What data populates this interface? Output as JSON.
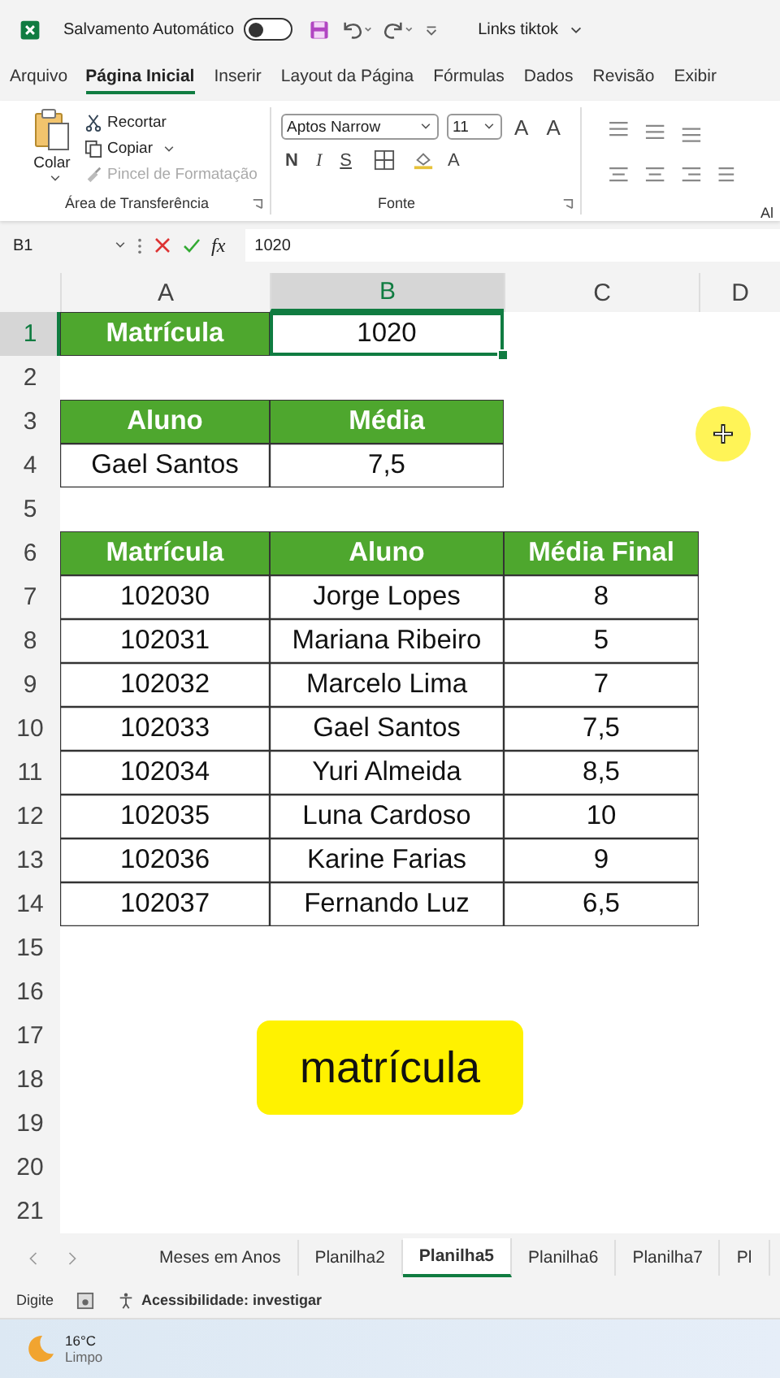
{
  "title_bar": {
    "autosave_label": "Salvamento Automático",
    "autosave_on": false,
    "file_name": "Links tiktok"
  },
  "menu_tabs": [
    {
      "label": "Arquivo",
      "selected": false
    },
    {
      "label": "Página Inicial",
      "selected": true
    },
    {
      "label": "Inserir",
      "selected": false
    },
    {
      "label": "Layout da Página",
      "selected": false
    },
    {
      "label": "Fórmulas",
      "selected": false
    },
    {
      "label": "Dados",
      "selected": false
    },
    {
      "label": "Revisão",
      "selected": false
    },
    {
      "label": "Exibir",
      "selected": false
    }
  ],
  "ribbon": {
    "clipboard": {
      "paste": "Colar",
      "items": [
        {
          "label": "Recortar",
          "disabled": false
        },
        {
          "label": "Copiar",
          "disabled": false
        },
        {
          "label": "Pincel de Formatação",
          "disabled": true
        }
      ],
      "group_label": "Área de Transferência"
    },
    "font": {
      "family": "Aptos Narrow",
      "size": "11",
      "size_buttons": [
        "A",
        "A"
      ],
      "style_buttons": [
        "N",
        "I",
        "S"
      ],
      "color_button": "A",
      "group_label": "Fonte"
    },
    "alignment": {
      "group_label": "Al"
    }
  },
  "formula_bar": {
    "name_box": "B1",
    "fx": "fx",
    "value": "1020"
  },
  "sheet": {
    "columns": [
      "A",
      "B",
      "C",
      "D"
    ],
    "rows": [
      {
        "number": "1",
        "cells": [
          {
            "text": "Matrícula",
            "kind": "header",
            "selected": false
          },
          {
            "text": "1020",
            "kind": "data",
            "selected": true
          }
        ]
      },
      {
        "number": "2",
        "cells": []
      },
      {
        "number": "3",
        "cells": [
          {
            "text": "Aluno",
            "kind": "header",
            "selected": false
          },
          {
            "text": "Média",
            "kind": "header",
            "selected": false
          }
        ]
      },
      {
        "number": "4",
        "cells": [
          {
            "text": "Gael Santos",
            "kind": "data",
            "selected": false
          },
          {
            "text": "7,5",
            "kind": "data",
            "selected": false
          }
        ]
      },
      {
        "number": "5",
        "cells": []
      },
      {
        "number": "6",
        "cells": [
          {
            "text": "Matrícula",
            "kind": "header",
            "selected": false
          },
          {
            "text": "Aluno",
            "kind": "header",
            "selected": false
          },
          {
            "text": "Média Final",
            "kind": "header",
            "selected": false
          }
        ]
      },
      {
        "number": "7",
        "cells": [
          {
            "text": "102030",
            "kind": "data",
            "selected": false
          },
          {
            "text": "Jorge Lopes",
            "kind": "data",
            "selected": false
          },
          {
            "text": "8",
            "kind": "data",
            "selected": false
          }
        ]
      },
      {
        "number": "8",
        "cells": [
          {
            "text": "102031",
            "kind": "data",
            "selected": false
          },
          {
            "text": "Mariana Ribeiro",
            "kind": "data",
            "selected": false
          },
          {
            "text": "5",
            "kind": "data",
            "selected": false
          }
        ]
      },
      {
        "number": "9",
        "cells": [
          {
            "text": "102032",
            "kind": "data",
            "selected": false
          },
          {
            "text": "Marcelo Lima",
            "kind": "data",
            "selected": false
          },
          {
            "text": "7",
            "kind": "data",
            "selected": false
          }
        ]
      },
      {
        "number": "10",
        "cells": [
          {
            "text": "102033",
            "kind": "data",
            "selected": false
          },
          {
            "text": "Gael Santos",
            "kind": "data",
            "selected": false
          },
          {
            "text": "7,5",
            "kind": "data",
            "selected": false
          }
        ]
      },
      {
        "number": "11",
        "cells": [
          {
            "text": "102034",
            "kind": "data",
            "selected": false
          },
          {
            "text": "Yuri Almeida",
            "kind": "data",
            "selected": false
          },
          {
            "text": "8,5",
            "kind": "data",
            "selected": false
          }
        ]
      },
      {
        "number": "12",
        "cells": [
          {
            "text": "102035",
            "kind": "data",
            "selected": false
          },
          {
            "text": "Luna Cardoso",
            "kind": "data",
            "selected": false
          },
          {
            "text": "10",
            "kind": "data",
            "selected": false
          }
        ]
      },
      {
        "number": "13",
        "cells": [
          {
            "text": "102036",
            "kind": "data",
            "selected": false
          },
          {
            "text": "Karine Farias",
            "kind": "data",
            "selected": false
          },
          {
            "text": "9",
            "kind": "data",
            "selected": false
          }
        ]
      },
      {
        "number": "14",
        "cells": [
          {
            "text": "102037",
            "kind": "data",
            "selected": false
          },
          {
            "text": "Fernando Luz",
            "kind": "data",
            "selected": false
          },
          {
            "text": "6,5",
            "kind": "data",
            "selected": false
          }
        ]
      },
      {
        "number": "15",
        "cells": []
      },
      {
        "number": "16",
        "cells": []
      },
      {
        "number": "17",
        "cells": []
      },
      {
        "number": "18",
        "cells": []
      },
      {
        "number": "19",
        "cells": []
      },
      {
        "number": "20",
        "cells": []
      },
      {
        "number": "21",
        "cells": []
      }
    ]
  },
  "caption": "matrícula",
  "sheet_tabs": [
    {
      "label": "Meses em Anos",
      "selected": false
    },
    {
      "label": "Planilha2",
      "selected": false
    },
    {
      "label": "Planilha5",
      "selected": true
    },
    {
      "label": "Planilha6",
      "selected": false
    },
    {
      "label": "Planilha7",
      "selected": false
    },
    {
      "label": "Pl",
      "selected": false
    }
  ],
  "status_bar": {
    "mode": "Digite",
    "accessibility": "Acessibilidade: investigar"
  },
  "taskbar": {
    "temperature": "16°C",
    "condition": "Limpo"
  }
}
